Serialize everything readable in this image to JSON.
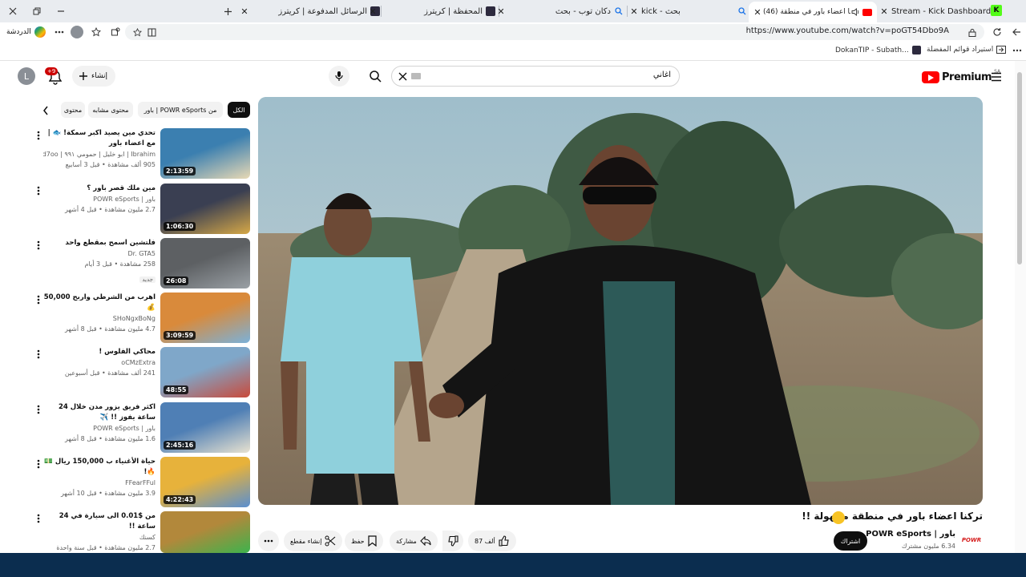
{
  "browser": {
    "tabs": [
      {
        "title": "Stream - Kick Dashboard",
        "favicon": "kick-logo",
        "active": false
      },
      {
        "title": "(46) تركنا اعضاء باور في منطقة",
        "favicon": "youtube-logo",
        "active": true
      },
      {
        "title": "kick - بحث",
        "favicon": "search-icon",
        "active": false
      },
      {
        "title": "دكان توب - بحث",
        "favicon": "search-icon",
        "active": false
      },
      {
        "title": "المحفظة | كريترز",
        "favicon": "critters-logo",
        "active": false
      },
      {
        "title": "الرسائل المدفوعة | كريترز",
        "favicon": "critters-logo",
        "active": false
      }
    ],
    "url": "https://www.youtube.com/watch?v=poGT54Dbo9A",
    "chat_label": "الدردشة",
    "bookmarks": [
      {
        "label": "استيراد قوائم المفضلة",
        "icon": "import-icon"
      },
      {
        "label": "DokanTIP - Subath...",
        "icon": "critters-logo"
      }
    ]
  },
  "youtube": {
    "brand": "Premium",
    "country": "SA",
    "search_query": "اغاني",
    "create_label": "إنشاء",
    "notification_count": "+9",
    "avatar_letter": "L",
    "chips": [
      "الكل",
      "من POWR eSports | باور",
      "محتوى مشابه",
      "محتوى"
    ],
    "video": {
      "title": "تركنا اعضاء باور في منطقة مجهولة !!",
      "channel": "باور | POWR eSports",
      "subscribers": "6.34 مليون مشترك",
      "subscribe_label": "اشتراك",
      "likes": "87 ألف",
      "share_label": "مشاركة",
      "save_label": "حفظ",
      "clip_label": "إنشاء مقطع"
    },
    "recommendations": [
      {
        "title": "تحدي مين يصيد اكبر سمكة! 🐟 | مع اعضاء باور",
        "channel": "Ibrahim | ابو خليل | حمومي ٩٩١ | d7oo",
        "meta": "905 ألف مشاهدة • قبل 3 أسابيع",
        "duration": "2:13:59",
        "badge": ""
      },
      {
        "title": "مين ملك قصر باور ؟",
        "channel": "باور | POWR eSports",
        "meta": "2.7 مليون مشاهدة • قبل 4 أشهر",
        "duration": "1:06:30",
        "badge": ""
      },
      {
        "title": "فلتشين اسمح بمقطع واحد",
        "channel": "Dr. GTA5",
        "meta": "258 مشاهدة • قبل 3 أيام",
        "duration": "26:08",
        "badge": "جديد"
      },
      {
        "title": "اهرب من الشرطي واربح 50,000 💰",
        "channel": "SHoNgxBoNg",
        "meta": "4.7 مليون مشاهدة • قبل 8 أشهر",
        "duration": "3:09:59",
        "badge": ""
      },
      {
        "title": "محاكي الفلوس !",
        "channel": "oCMzExtra",
        "meta": "241 ألف مشاهدة • قبل أسبوعين",
        "duration": "48:55",
        "badge": ""
      },
      {
        "title": "اكثر فريق يزور مدن خلال 24 ساعة يفوز !! ✈️",
        "channel": "باور | POWR eSports",
        "meta": "1.6 مليون مشاهدة • قبل 8 أشهر",
        "duration": "2:45:16",
        "badge": ""
      },
      {
        "title": "حياة الأغنياء ب 150,000 ريال 💵🔥!",
        "channel": "FFearFFul",
        "meta": "3.9 مليون مشاهدة • قبل 10 أشهر",
        "duration": "4:22:43",
        "badge": ""
      },
      {
        "title": "من $0.01 الى سيارة في 24 ساعة !!",
        "channel": "كسنك",
        "meta": "2.7 مليون مشاهدة • قبل سنة واحدة",
        "duration": "",
        "badge": ""
      }
    ]
  }
}
